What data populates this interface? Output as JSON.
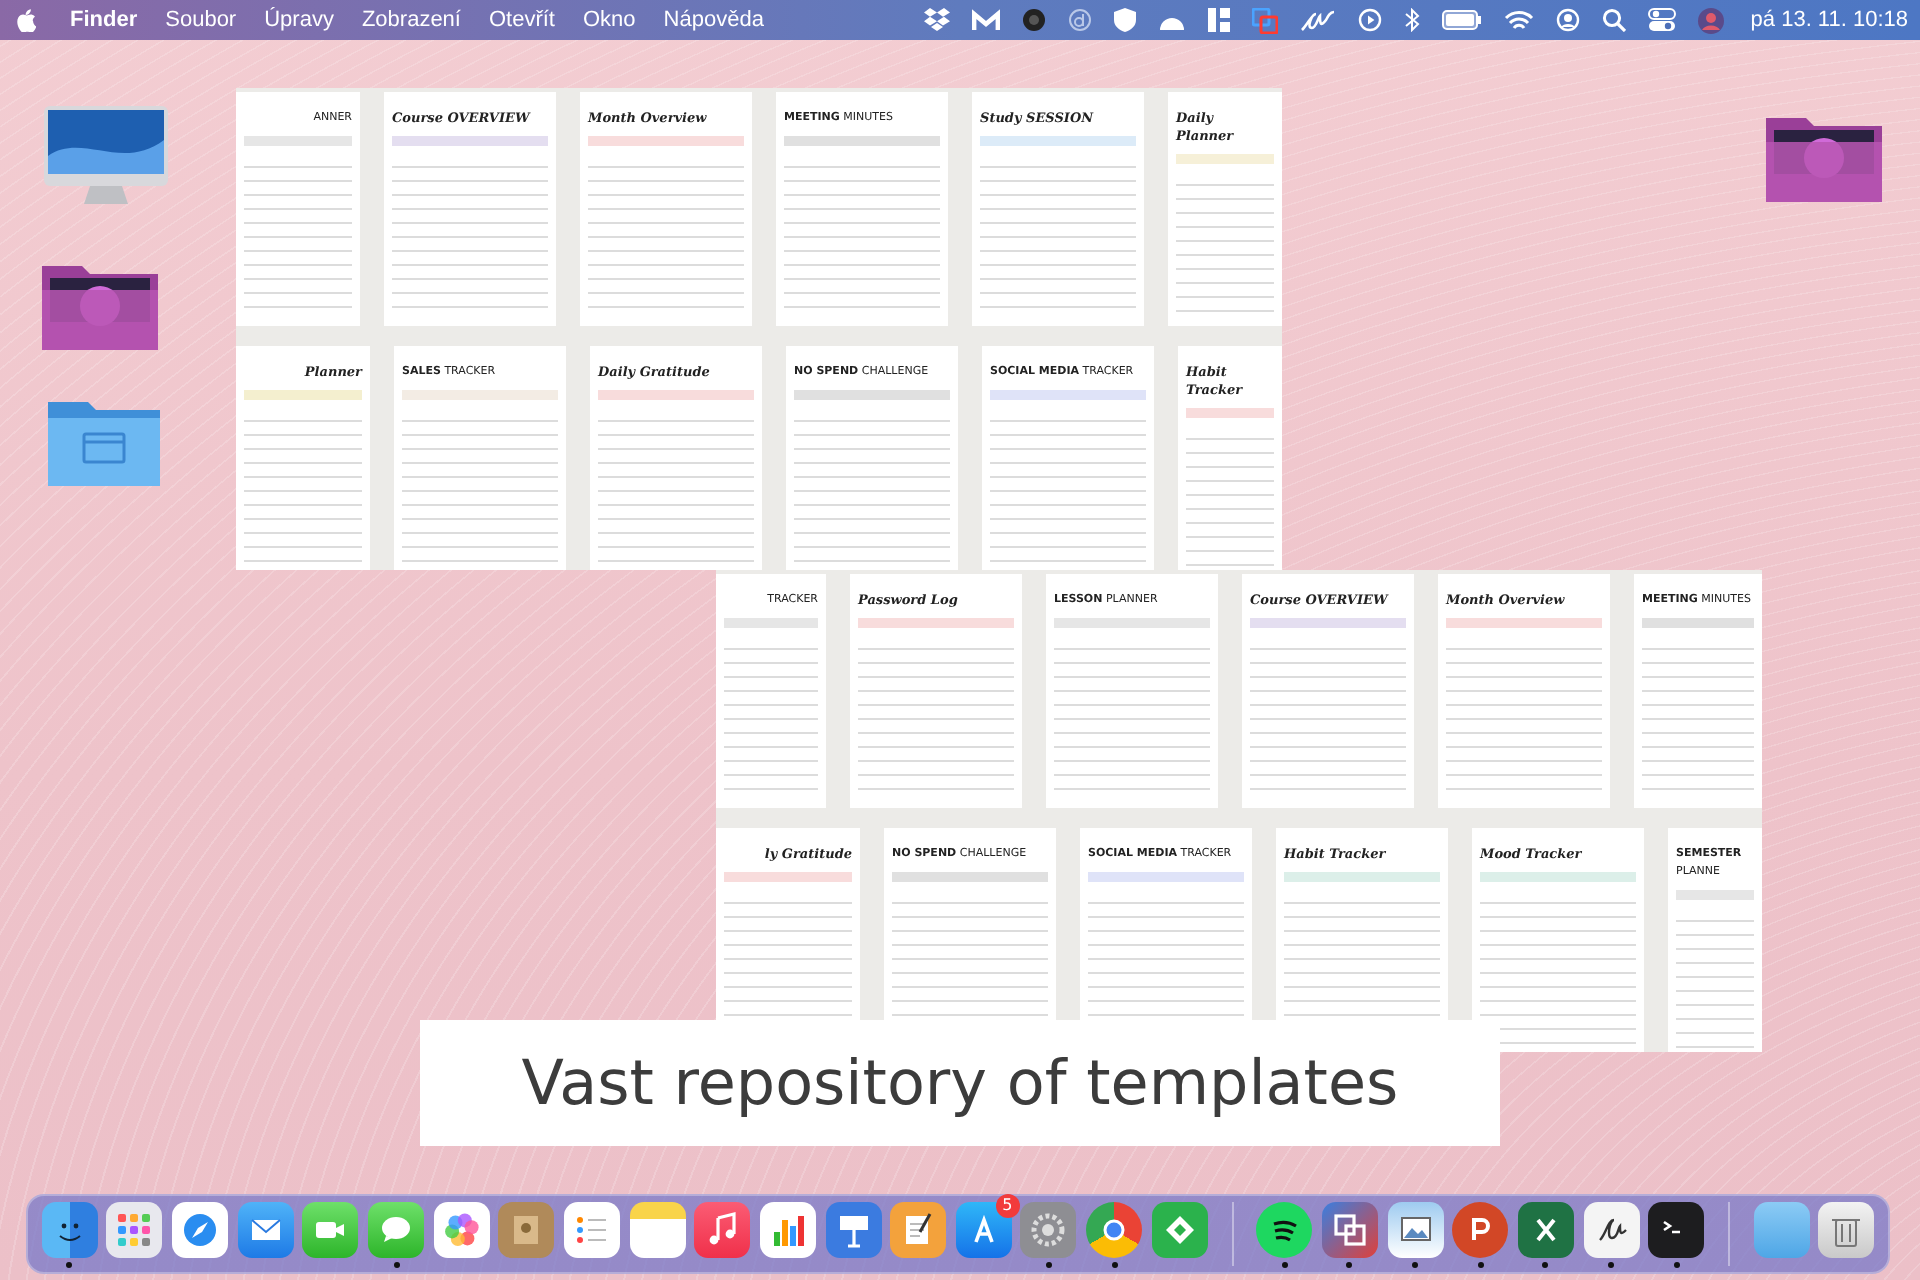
{
  "menu_bar": {
    "menus": [
      "Finder",
      "Soubor",
      "Úpravy",
      "Zobrazení",
      "Otevřít",
      "Okno",
      "Nápověda"
    ],
    "clock": "pá 13. 11. 10:18"
  },
  "collages": [
    {
      "rows": [
        [
          {
            "title": "ANNER",
            "kind": "caps",
            "color": "#e6e6e6"
          },
          {
            "title": "Course **OVERVIEW**",
            "kind": "script",
            "color": "#e4def0"
          },
          {
            "title": "Month Overview",
            "kind": "script",
            "color": "#f8dcdc"
          },
          {
            "title": "**MEETING** MINUTES",
            "kind": "caps",
            "color": "#e0e0e0"
          },
          {
            "title": "Study **SESSION**",
            "kind": "script",
            "color": "#dcebf8"
          },
          {
            "title": "Daily Planner",
            "kind": "script",
            "color": "#f6f0d8"
          }
        ],
        [
          {
            "title": "Planner",
            "kind": "script",
            "color": "#f4efcf"
          },
          {
            "title": "**SALES** TRACKER",
            "kind": "caps",
            "color": "#f3ece4"
          },
          {
            "title": "Daily Gratitude",
            "kind": "script",
            "color": "#f8dcdc"
          },
          {
            "title": "**NO SPEND** CHALLENGE",
            "kind": "caps",
            "color": "#e0e0e0"
          },
          {
            "title": "**SOCIAL MEDIA** TRACKER",
            "kind": "caps",
            "color": "#dfe3f8"
          },
          {
            "title": "Habit Tracker",
            "kind": "script",
            "color": "#f8dcdc"
          }
        ]
      ]
    },
    {
      "rows": [
        [
          {
            "title": "TRACKER",
            "kind": "caps",
            "color": "#e6e6e6"
          },
          {
            "title": "Password Log",
            "kind": "script",
            "color": "#f8dcdc"
          },
          {
            "title": "**LESSON** PLANNER",
            "kind": "caps",
            "color": "#e6e6e6"
          },
          {
            "title": "Course **OVERVIEW**",
            "kind": "script",
            "color": "#e4def0"
          },
          {
            "title": "Month Overview",
            "kind": "script",
            "color": "#f8dcdc"
          },
          {
            "title": "**MEETING** MINUTES",
            "kind": "caps",
            "color": "#e0e0e0"
          }
        ],
        [
          {
            "title": "ly Gratitude",
            "kind": "script",
            "color": "#f8dcdc"
          },
          {
            "title": "**NO SPEND** CHALLENGE",
            "kind": "caps",
            "color": "#e0e0e0"
          },
          {
            "title": "**SOCIAL MEDIA** TRACKER",
            "kind": "caps",
            "color": "#dfe3f8"
          },
          {
            "title": "Habit Tracker",
            "kind": "script",
            "color": "#dcefe9"
          },
          {
            "title": "Mood Tracker",
            "kind": "script",
            "color": "#dcefe9"
          },
          {
            "title": "**SEMESTER** PLANNE",
            "kind": "caps",
            "color": "#e6e6e6"
          }
        ]
      ]
    }
  ],
  "caption": "Vast repository of templates",
  "dock": {
    "apps": [
      {
        "kind": "finder",
        "running": true
      },
      {
        "kind": "launchpad",
        "running": false
      },
      {
        "kind": "safari",
        "running": false
      },
      {
        "kind": "mail",
        "running": false
      },
      {
        "kind": "facetime",
        "running": false
      },
      {
        "kind": "messages",
        "running": true
      },
      {
        "kind": "photos",
        "running": false
      },
      {
        "kind": "contacts",
        "running": false
      },
      {
        "kind": "reminders",
        "running": false
      },
      {
        "kind": "notes",
        "running": false
      },
      {
        "kind": "music",
        "running": false
      },
      {
        "kind": "numbers",
        "running": false
      },
      {
        "kind": "keynote",
        "running": false
      },
      {
        "kind": "pages",
        "running": false
      },
      {
        "kind": "appstore",
        "running": false,
        "badge": "5"
      },
      {
        "kind": "settings",
        "running": true
      },
      {
        "kind": "chrome",
        "running": true
      },
      {
        "kind": "feedly",
        "running": false
      }
    ],
    "extra_apps": [
      {
        "kind": "spotify",
        "running": true
      },
      {
        "kind": "parallels",
        "running": true
      },
      {
        "kind": "preview",
        "running": true
      },
      {
        "kind": "powerpoint",
        "running": true
      },
      {
        "kind": "excel",
        "running": true
      },
      {
        "kind": "script",
        "running": true
      },
      {
        "kind": "terminal",
        "running": true
      }
    ],
    "stacks": [
      {
        "kind": "folder",
        "running": false
      },
      {
        "kind": "trash",
        "running": false
      }
    ]
  }
}
